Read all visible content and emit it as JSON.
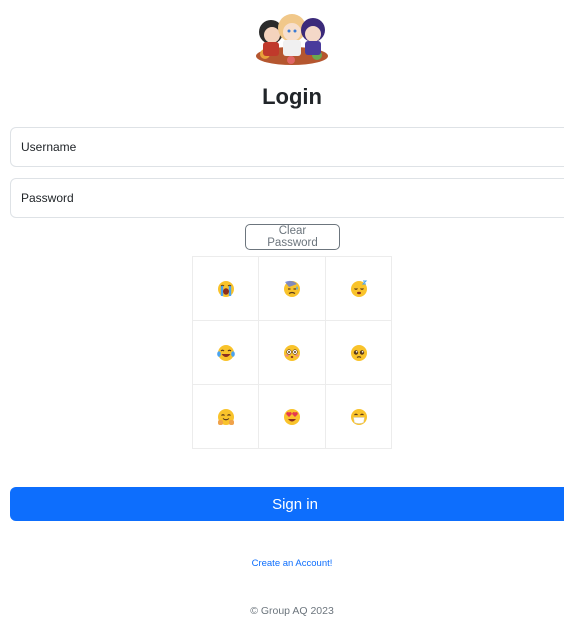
{
  "login": {
    "title": "Login",
    "username_placeholder": "Username",
    "password_placeholder": "Password",
    "clear_password_label": "Clear Password",
    "sign_in_label": "Sign in",
    "create_account_label": "Create an Account!",
    "footer": "© Group AQ 2023"
  },
  "emoji_grid": [
    {
      "name": "loudly-crying-face-icon"
    },
    {
      "name": "downcast-face-with-sweat-icon"
    },
    {
      "name": "sleeping-face-icon"
    },
    {
      "name": "rolling-on-floor-laughing-icon"
    },
    {
      "name": "flushed-face-icon"
    },
    {
      "name": "pleading-face-icon"
    },
    {
      "name": "smiling-face-with-open-hands-icon"
    },
    {
      "name": "smiling-face-with-heart-eyes-icon"
    },
    {
      "name": "face-with-medical-mask-icon"
    }
  ],
  "colors": {
    "primary": "#0d6efd",
    "emoji_yellow": "#f9c32b",
    "border": "#dee2e6",
    "muted": "#6c757d"
  }
}
